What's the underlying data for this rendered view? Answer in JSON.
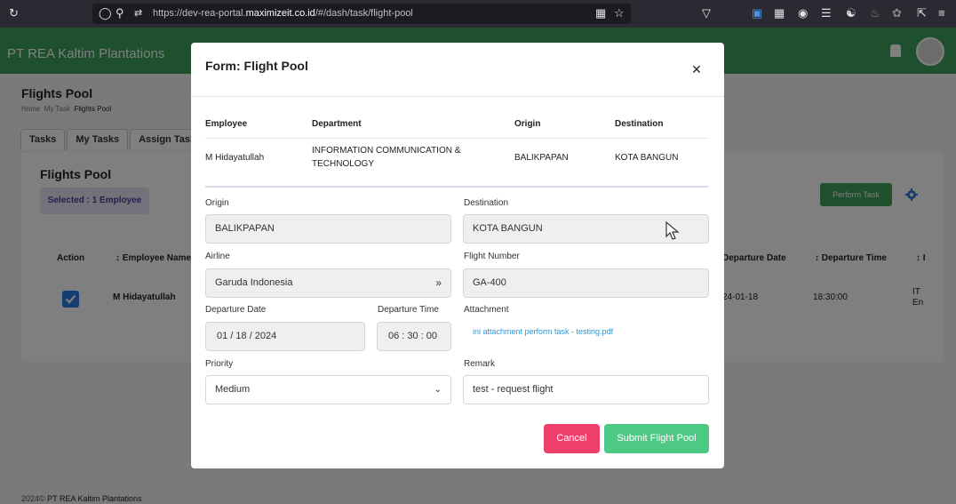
{
  "browser": {
    "url_prefix": "https://dev-rea-portal.",
    "url_domain": "maximizeit.co.id",
    "url_path": "/#/dash/task/flight-pool"
  },
  "header": {
    "brand": "PT REA Kaltim Plantations"
  },
  "page": {
    "title": "Flights Pool",
    "breadcrumb": [
      "Home",
      "My Task",
      "Flights Pool"
    ],
    "tabs": [
      "Tasks",
      "My Tasks",
      "Assign Task"
    ],
    "card_title": "Flights Pool",
    "selected_label": "Selected : 1 Employee",
    "perform_task": "Perform Task",
    "table_headers": {
      "action": "Action",
      "employee_name": "↕ Employee Name",
      "departure_date": "Departure Date",
      "departure_time": "↕ Departure Time",
      "last": "↕ I"
    },
    "row": {
      "employee_name": "M Hidayatullah",
      "departure_date": "24-01-18",
      "departure_time": "18:30:00",
      "last_1": "IT",
      "last_2": "En"
    },
    "footer_year": "2024©",
    "footer_company": "PT REA Kaltim Plantations"
  },
  "modal": {
    "title": "Form: Flight Pool",
    "table": {
      "headers": [
        "Employee",
        "Department",
        "Origin",
        "Destination"
      ],
      "row": {
        "employee": "M Hidayatullah",
        "department_line1": "INFORMATION COMMUNICATION &",
        "department_line2": "TECHNOLOGY",
        "origin": "BALIKPAPAN",
        "destination": "KOTA BANGUN"
      }
    },
    "labels": {
      "origin": "Origin",
      "destination": "Destination",
      "airline": "Airline",
      "flight_number": "Flight Number",
      "departure_date": "Departure Date",
      "departure_time": "Departure Time",
      "attachment": "Attachment",
      "priority": "Priority",
      "remark": "Remark"
    },
    "values": {
      "origin": "BALIKPAPAN",
      "destination": "KOTA BANGUN",
      "airline": "Garuda Indonesia",
      "flight_number": "GA-400",
      "departure_date": "01 / 18 / 2024",
      "departure_time": "06 : 30 : 00",
      "attachment": "ini attachment perform task - testing.pdf",
      "priority": "Medium",
      "remark": "test - request flight"
    },
    "buttons": {
      "cancel": "Cancel",
      "submit": "Submit Flight Pool"
    }
  }
}
